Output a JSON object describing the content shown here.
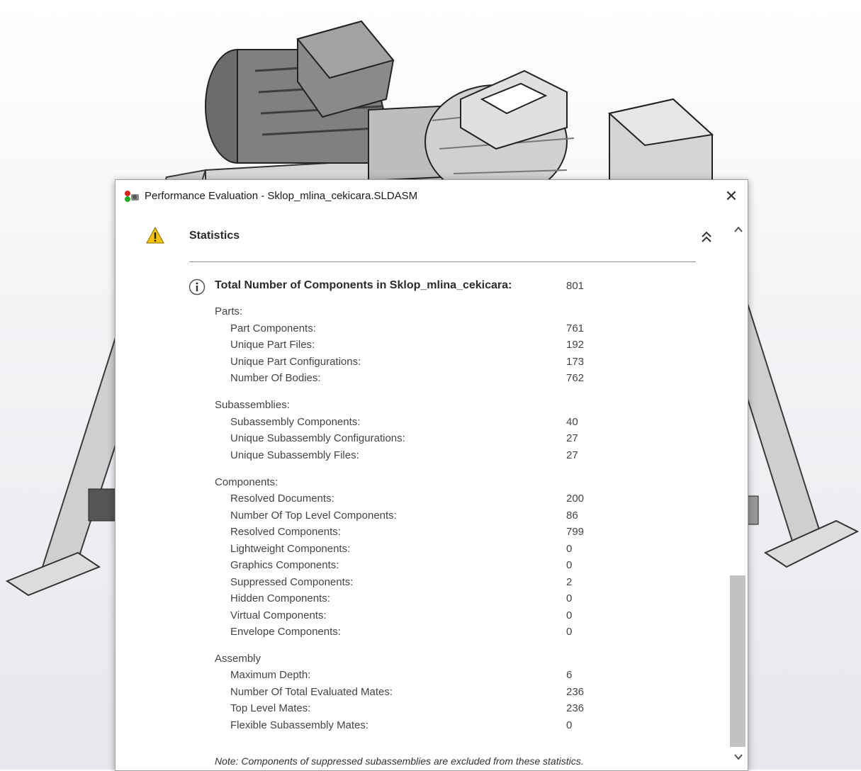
{
  "window": {
    "title": "Performance Evaluation - Sklop_mlina_cekicara.SLDASM",
    "close": "✕"
  },
  "section": {
    "title": "Statistics"
  },
  "total": {
    "label": "Total Number of Components in Sklop_mlina_cekicara:",
    "value": "801"
  },
  "parts": {
    "heading": "Parts:",
    "rows": [
      {
        "label": "Part Components:",
        "value": "761"
      },
      {
        "label": "Unique Part Files:",
        "value": "192"
      },
      {
        "label": "Unique Part Configurations:",
        "value": "173"
      },
      {
        "label": "Number Of Bodies:",
        "value": "762"
      }
    ]
  },
  "subassemblies": {
    "heading": "Subassemblies:",
    "rows": [
      {
        "label": "Subassembly Components:",
        "value": "40"
      },
      {
        "label": "Unique Subassembly Configurations:",
        "value": "27"
      },
      {
        "label": "Unique Subassembly Files:",
        "value": "27"
      }
    ]
  },
  "components": {
    "heading": "Components:",
    "rows": [
      {
        "label": "Resolved Documents:",
        "value": "200"
      },
      {
        "label": "Number Of Top Level Components:",
        "value": "86"
      },
      {
        "label": "Resolved Components:",
        "value": "799"
      },
      {
        "label": "Lightweight Components:",
        "value": "0"
      },
      {
        "label": "Graphics Components:",
        "value": "0"
      },
      {
        "label": "Suppressed Components:",
        "value": "2"
      },
      {
        "label": "Hidden Components:",
        "value": "0"
      },
      {
        "label": "Virtual Components:",
        "value": "0"
      },
      {
        "label": "Envelope Components:",
        "value": "0"
      }
    ]
  },
  "assembly": {
    "heading": "Assembly",
    "rows": [
      {
        "label": "Maximum Depth:",
        "value": "6"
      },
      {
        "label": "Number Of Total Evaluated Mates:",
        "value": "236"
      },
      {
        "label": "Top Level Mates:",
        "value": "236"
      },
      {
        "label": "Flexible Subassembly Mates:",
        "value": "0"
      }
    ]
  },
  "note": "Note: Components of suppressed subassemblies are excluded from these statistics.",
  "colors": {
    "warning": "#f5c400",
    "info_ring": "#555555",
    "model": "#7a7a7a"
  },
  "icons": {
    "app": "traffic-light-icon",
    "warning": "warning-triangle-icon",
    "info": "info-circle-icon",
    "collapse": "double-chevron-up-icon"
  }
}
